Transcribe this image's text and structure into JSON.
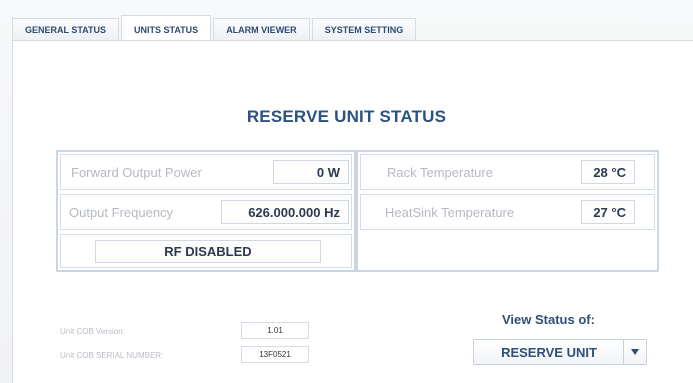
{
  "tabs": [
    {
      "label": "GENERAL STATUS"
    },
    {
      "label": "UNITS STATUS"
    },
    {
      "label": "ALARM VIEWER"
    },
    {
      "label": "SYSTEM SETTING"
    }
  ],
  "active_tab": "UNITS STATUS",
  "page_title": "RESERVE UNIT STATUS",
  "status": {
    "forward_output_power": {
      "label": "Forward Output Power",
      "value": "0 W"
    },
    "output_frequency": {
      "label": "Output Frequency",
      "value": "626.000.000 Hz"
    },
    "rf_state": "RF DISABLED",
    "rack_temperature": {
      "label": "Rack Temperature",
      "value": "28 °C"
    },
    "heatsink_temperature": {
      "label": "HeatSink Temperature",
      "value": "27 °C"
    }
  },
  "unit_info": {
    "cob_version": {
      "label": "Unit COB Version:",
      "value": "1.01"
    },
    "cob_serial": {
      "label": "Unit COB SERIAL NUMBER:",
      "value": "13F0521"
    }
  },
  "view_status": {
    "label": "View Status of:",
    "selected": "RESERVE UNIT",
    "arrow_icon": "chevron-down-icon"
  },
  "colors": {
    "title": "#2a5282",
    "panel_border": "#c9d6e6",
    "muted_label": "#b5bac1"
  }
}
